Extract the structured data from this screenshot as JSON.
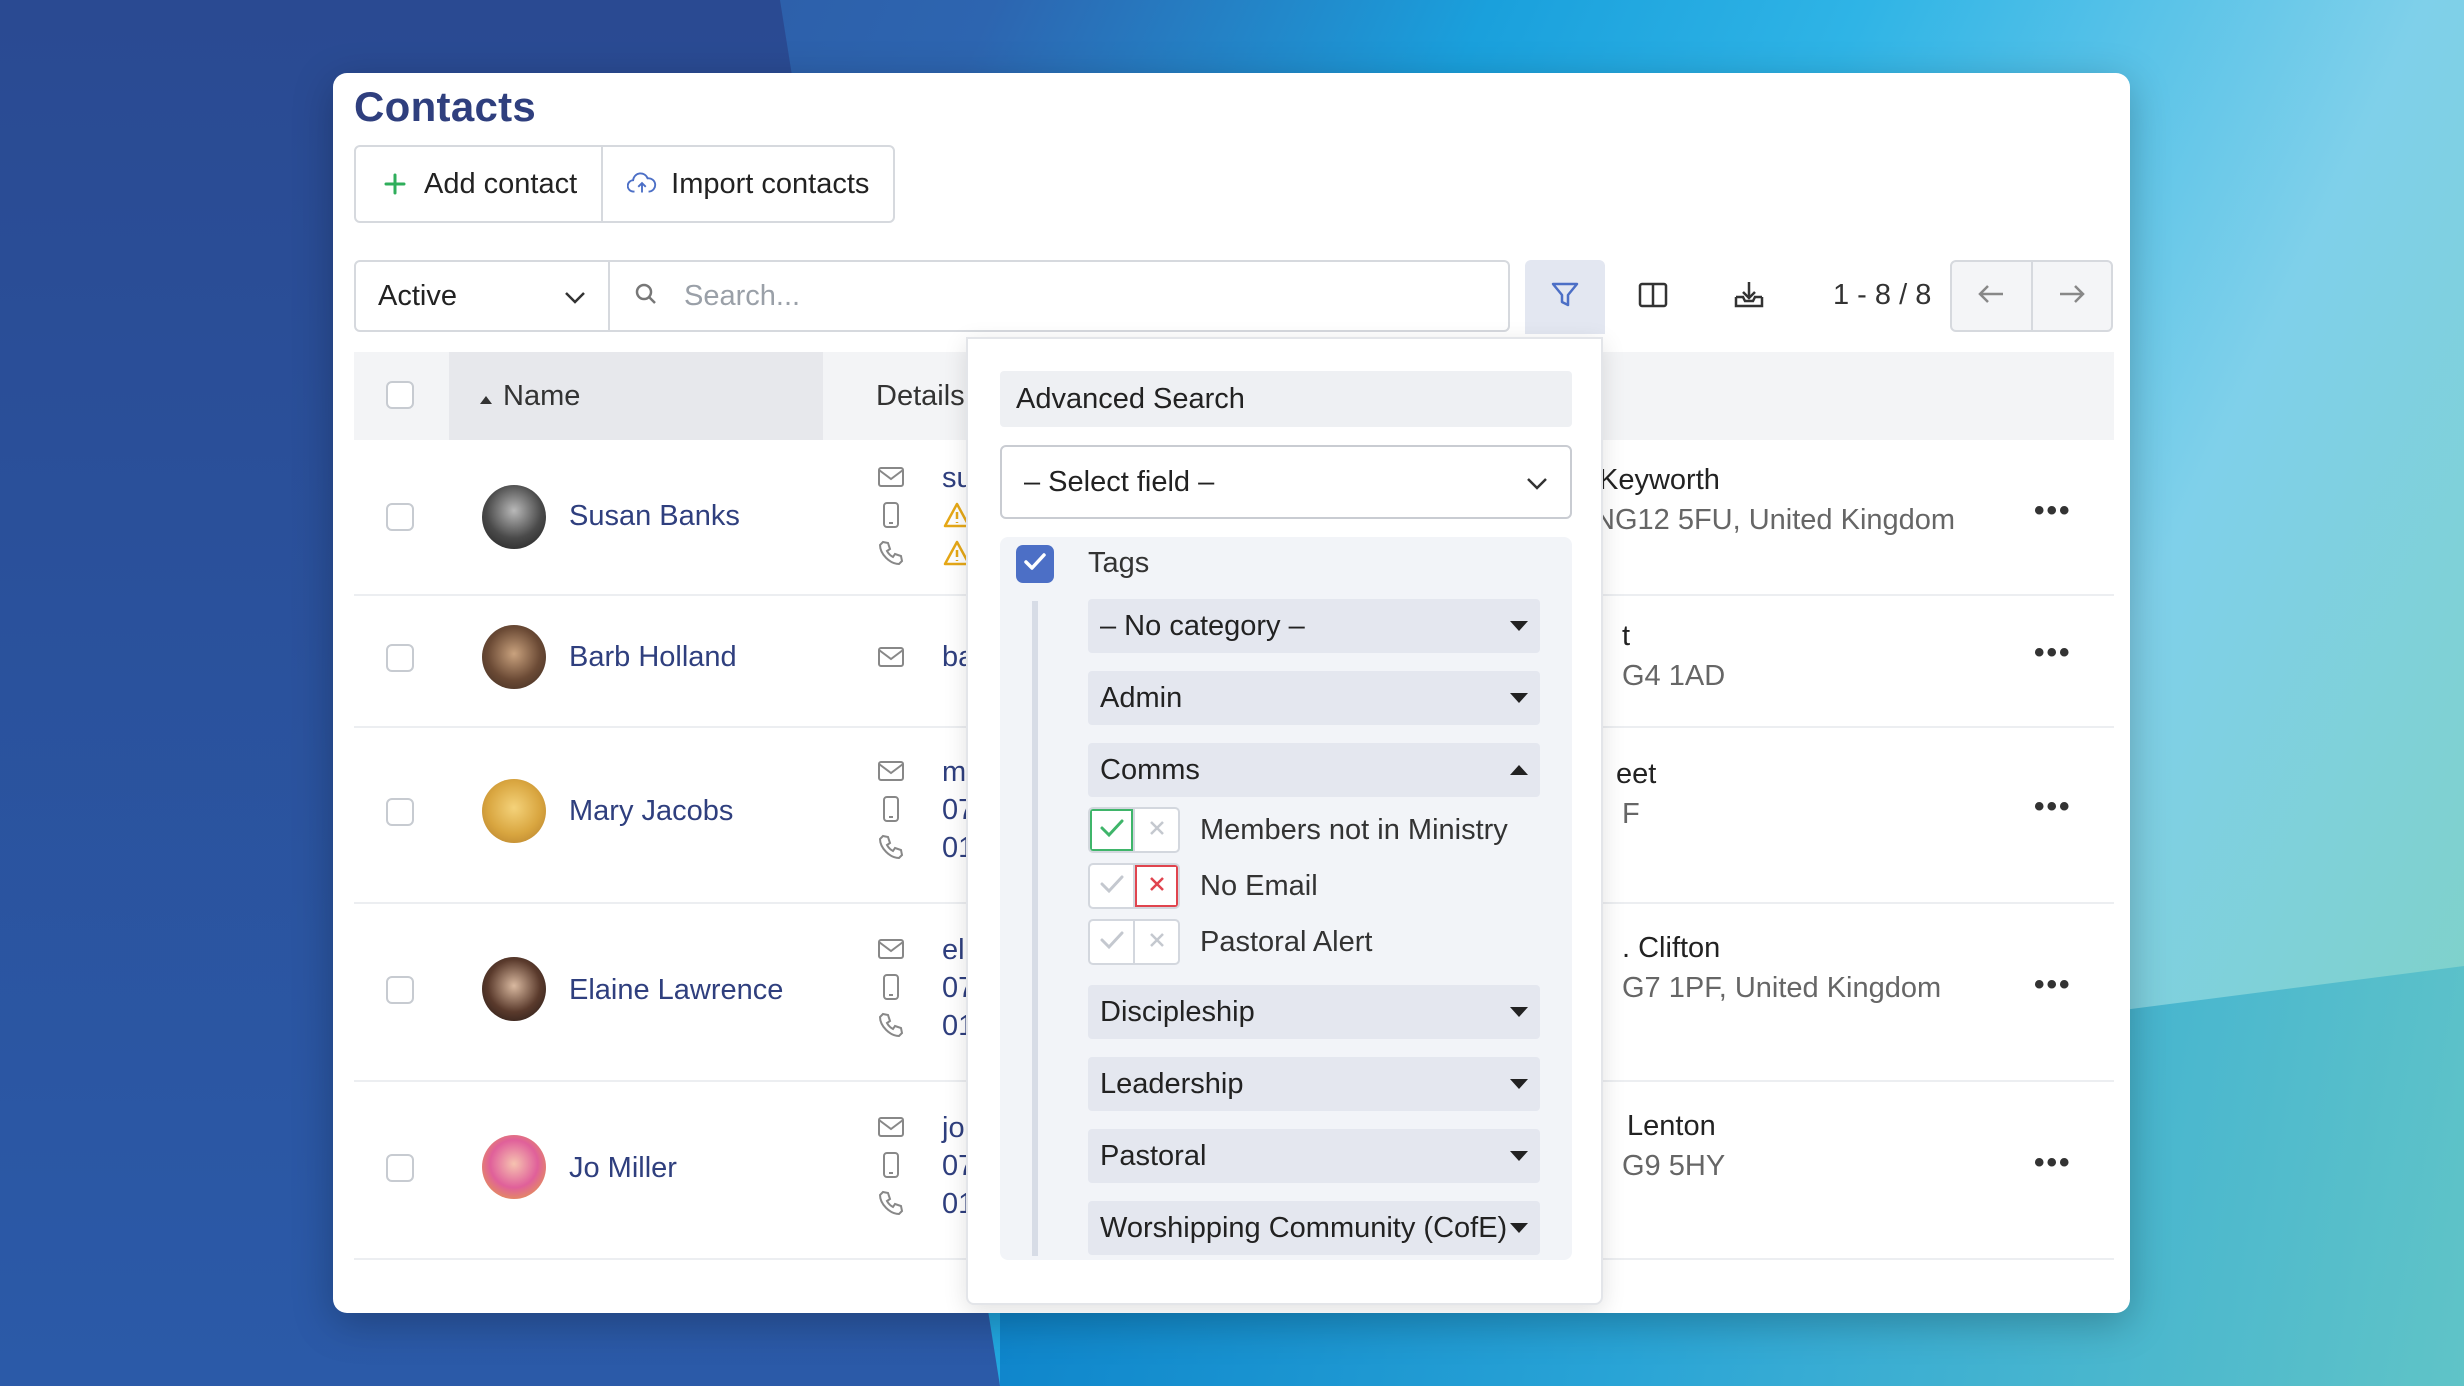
{
  "page": {
    "title": "Contacts"
  },
  "toolbar": {
    "add_label": "Add contact",
    "import_label": "Import contacts"
  },
  "filter": {
    "status_value": "Active",
    "search_placeholder": "Search...",
    "pager_text": "1 - 8 / 8"
  },
  "table": {
    "columns": {
      "name": "Name",
      "details": "Details"
    },
    "rows": [
      {
        "name": "Susan Banks",
        "details": [
          "su",
          "",
          ""
        ],
        "detail_icons": [
          "mail-icon",
          "mobile-icon",
          "phone-icon"
        ],
        "address_line1": "Keyworth",
        "address_line2": "NG12 5FU, United Kingdom"
      },
      {
        "name": "Barb Holland",
        "details": [
          "ba"
        ],
        "detail_icons": [
          "mail-icon"
        ],
        "address_line1": "t",
        "address_line2": "G4 1AD"
      },
      {
        "name": "Mary Jacobs",
        "details": [
          "m",
          "07",
          "01"
        ],
        "detail_icons": [
          "mail-icon",
          "mobile-icon",
          "phone-icon"
        ],
        "address_line1": "eet",
        "address_line2": "F"
      },
      {
        "name": "Elaine Lawrence",
        "details": [
          "el",
          "07",
          "01"
        ],
        "detail_icons": [
          "mail-icon",
          "mobile-icon",
          "phone-icon"
        ],
        "address_line1": ". Clifton",
        "address_line2": "G7 1PF, United Kingdom"
      },
      {
        "name": "Jo Miller",
        "details": [
          "jo",
          "07",
          "01"
        ],
        "detail_icons": [
          "mail-icon",
          "mobile-icon",
          "phone-icon"
        ],
        "address_line1": "Lenton",
        "address_line2": "G9 5HY"
      }
    ]
  },
  "advanced": {
    "title": "Advanced Search",
    "select_field": "– Select field –",
    "tags_label": "Tags",
    "tags_checked": true,
    "categories": {
      "no_category": "– No category –",
      "admin": "Admin",
      "comms": "Comms",
      "discipleship": "Discipleship",
      "leadership": "Leadership",
      "pastoral": "Pastoral",
      "worshipping": "Worshipping Community (CofE)"
    },
    "comms_tags": [
      {
        "label": "Members not in Ministry",
        "state": "include"
      },
      {
        "label": "No Email",
        "state": "exclude"
      },
      {
        "label": "Pastoral Alert",
        "state": "none"
      }
    ]
  },
  "colors": {
    "accent": "#2f3f7e",
    "check_blue": "#4c6fc6",
    "include_green": "#3fb56a",
    "exclude_red": "#e0444e",
    "warning": "#e6a817"
  },
  "row_action_label": "•••"
}
